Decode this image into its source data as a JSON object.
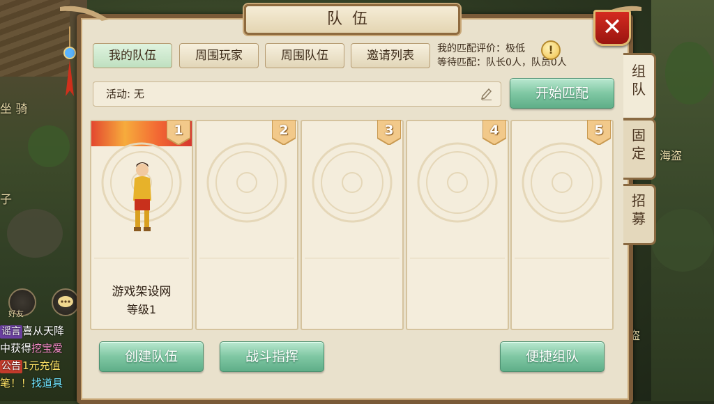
{
  "window": {
    "title": "队伍",
    "close_label": "✕"
  },
  "side_tabs": [
    {
      "chars": [
        "组",
        "队"
      ],
      "active": true
    },
    {
      "chars": [
        "固",
        "定"
      ],
      "active": false
    },
    {
      "chars": [
        "招",
        "募"
      ],
      "active": false
    }
  ],
  "tabs": [
    "我的队伍",
    "周围玩家",
    "周围队伍",
    "邀请列表"
  ],
  "active_tab": "我的队伍",
  "match": {
    "rating_line": "我的匹配评价：极低",
    "waiting_line": "等待匹配：队长0人，队员0人",
    "start_label": "开始匹配"
  },
  "activity": {
    "text": "活动: 无"
  },
  "slots": [
    {
      "number": "1",
      "name": "游戏架设网",
      "level": "等级1"
    },
    {
      "number": "2"
    },
    {
      "number": "3"
    },
    {
      "number": "4"
    },
    {
      "number": "5"
    }
  ],
  "actions": {
    "create_team": "创建队伍",
    "battle_command": "战斗指挥",
    "quick_team": "便捷组队"
  },
  "background": {
    "left_labels": [
      "坐  骑",
      "子"
    ],
    "right_labels": [
      "海盗",
      "盗"
    ],
    "friend_label": "好友",
    "chat": [
      {
        "tag": "谣言",
        "text": "喜从天降"
      },
      {
        "prefix": "中获得",
        "highlight": "挖宝爱"
      },
      {
        "tag": "公告",
        "text": "1元充值"
      },
      {
        "prefix": "笔！！",
        "highlight": "找道具"
      }
    ]
  },
  "colors": {
    "accent_green": "#7fc7a3",
    "close_red": "#c8231a",
    "frame_brown": "#7a5a38"
  }
}
